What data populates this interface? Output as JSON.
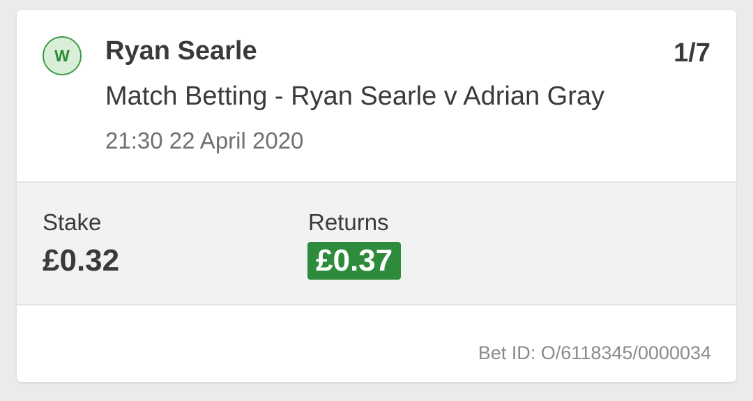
{
  "bet": {
    "result_badge": "W",
    "selection_name": "Ryan Searle",
    "odds": "1/7",
    "market_name": "Match Betting - Ryan Searle v Adrian Gray",
    "event_time": "21:30 22 April 2020"
  },
  "summary": {
    "stake_label": "Stake",
    "stake_value": "£0.32",
    "returns_label": "Returns",
    "returns_value": "£0.37"
  },
  "footer": {
    "bet_id": "Bet ID: O/6118345/0000034"
  },
  "colors": {
    "win_green": "#2e8b3b",
    "badge_bg": "#d8eed9",
    "panel_bg": "#f1f3f3",
    "text_dark": "#3a3a3a",
    "text_muted": "#707070"
  },
  "icons": {
    "result_badge": "win-badge-icon"
  }
}
